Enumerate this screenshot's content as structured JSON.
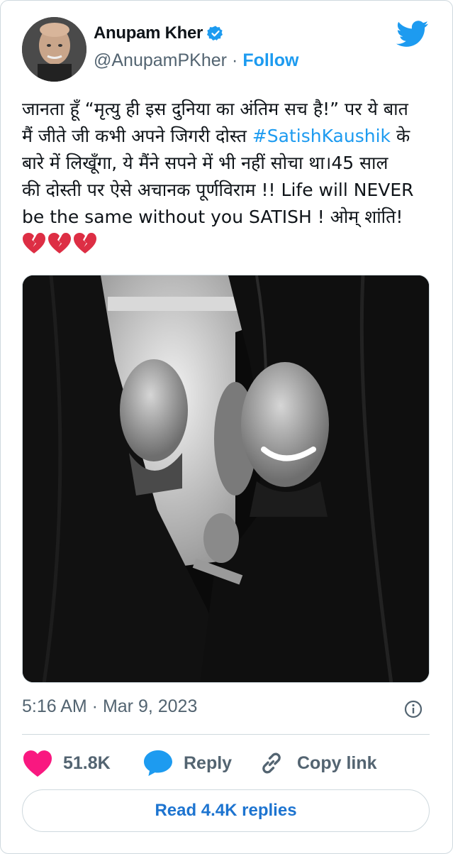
{
  "author": {
    "name": "Anupam Kher",
    "handle": "@AnupamPKher",
    "separator": "·",
    "follow_label": "Follow",
    "verified": true
  },
  "tweet": {
    "lines": [
      "जानता हूँ “मृत्यु ही इस दुनिया का अंतिम सच है!” पर ये बात",
      "मैं जीते जी कभी अपने जिगरी दोस्त ",
      "#SatishKaushik",
      " के",
      "बारे में लिखूँगा, ये मैंने सपने में भी नहीं सोचा था।45 साल",
      "की दोस्ती पर ऐसे अचानक पूर्णविराम !! Life will NEVER",
      "be the same without you SATISH ! ओम् शांति!"
    ],
    "emoji": [
      "💔",
      "💔",
      "💔"
    ]
  },
  "timestamp": "5:16 AM · Mar 9, 2023",
  "actions": {
    "likes": "51.8K",
    "reply_label": "Reply",
    "copy_label": "Copy link"
  },
  "read_replies_label": "Read 4.4K replies",
  "colors": {
    "accent": "#1d9bf0",
    "heart": "#f91880",
    "muted": "#536471"
  },
  "icons": [
    "verified-badge-icon",
    "twitter-bird-icon",
    "info-icon",
    "heart-icon",
    "reply-bubble-icon",
    "link-icon"
  ]
}
